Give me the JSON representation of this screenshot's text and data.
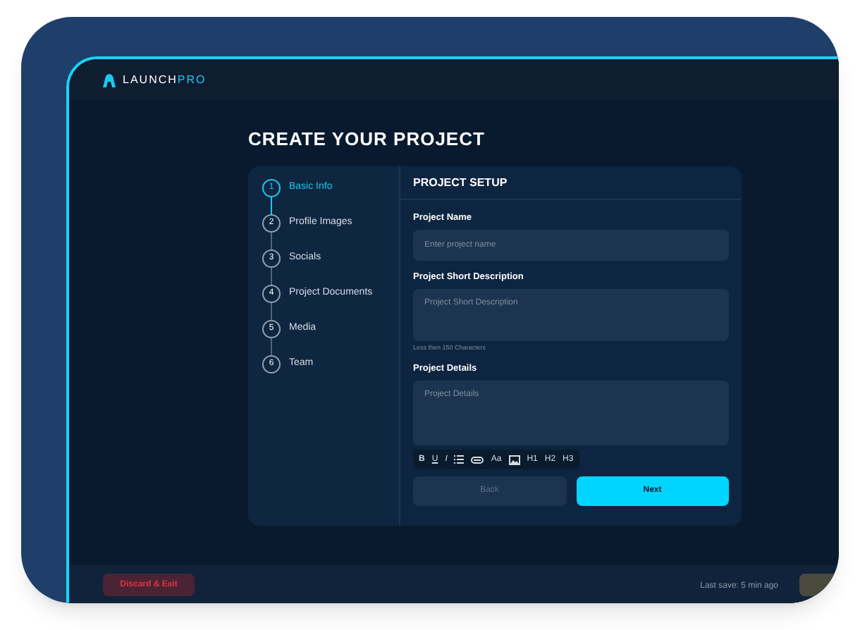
{
  "app": {
    "logo": {
      "brand": "LAUNCH",
      "brand_accent": "PRO"
    }
  },
  "page_title": "CREATE YOUR PROJECT",
  "steps": [
    {
      "number": "1",
      "label": "Basic Info",
      "selected": true
    },
    {
      "number": "2",
      "label": "Profile Images",
      "selected": false
    },
    {
      "number": "3",
      "label": "Socials",
      "selected": false
    },
    {
      "number": "4",
      "label": "Project Documents",
      "selected": false
    },
    {
      "number": "5",
      "label": "Media",
      "selected": false
    },
    {
      "number": "6",
      "label": "Team",
      "selected": false
    }
  ],
  "form": {
    "title": "PROJECT SETUP",
    "fields": [
      {
        "kind": "input",
        "label": "Project Name",
        "placeholder": "Enter project name"
      },
      {
        "kind": "textarea",
        "label": "Project Short Description",
        "placeholder": "Project Short Description",
        "hint": "Less then 150 Characters"
      },
      {
        "kind": "editor",
        "label": "Project Details",
        "placeholder": "Project Details",
        "toolbar": [
          {
            "kind": "text",
            "label": "B"
          },
          {
            "kind": "text",
            "label": "U"
          },
          {
            "kind": "text",
            "label": "I"
          },
          {
            "kind": "list"
          },
          {
            "kind": "link"
          },
          {
            "kind": "text",
            "label": "Aa"
          },
          {
            "kind": "image"
          },
          {
            "kind": "text",
            "label": "H1"
          },
          {
            "kind": "text",
            "label": "H2"
          },
          {
            "kind": "text",
            "label": "H3"
          }
        ]
      }
    ],
    "buttons": [
      {
        "label": "Back",
        "disabled": true
      },
      {
        "label": "Next",
        "disabled": false
      }
    ]
  },
  "footer": {
    "discard": "Discard & Exit",
    "last_save": "Last save: 5 min ago"
  }
}
